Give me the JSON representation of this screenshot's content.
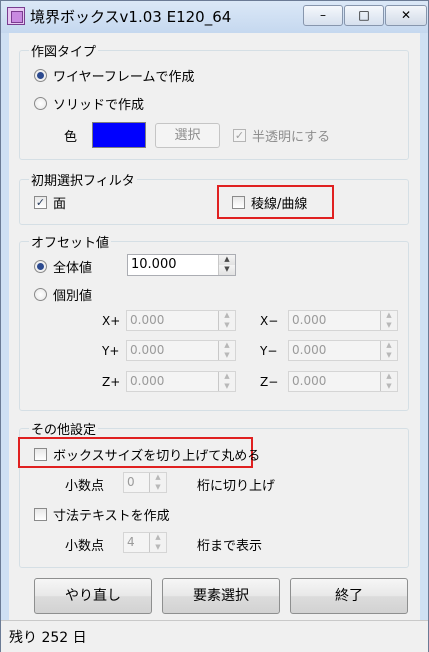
{
  "window": {
    "title": "境界ボックスv1.03 E120_64",
    "controls": {
      "minimize": "–",
      "maximize": "□",
      "close": "✕"
    }
  },
  "draw_type": {
    "legend": "作図タイプ",
    "wireframe_label": "ワイヤーフレームで作成",
    "wireframe_selected": true,
    "solid_label": "ソリッドで作成",
    "solid_selected": false,
    "color_label": "色",
    "color_value": "#0000ff",
    "select_button": "選択",
    "translucent_label": "半透明にする",
    "translucent_checked": true
  },
  "filter": {
    "legend": "初期選択フィルタ",
    "face_label": "面",
    "face_checked": true,
    "edge_label": "稜線/曲線",
    "edge_checked": false
  },
  "offset": {
    "legend": "オフセット値",
    "all_label": "全体値",
    "all_selected": true,
    "all_value": "10.000",
    "individual_label": "個別値",
    "individual_selected": false,
    "axes": {
      "xp": {
        "label": "X+",
        "value": "0.000"
      },
      "xm": {
        "label": "X−",
        "value": "0.000"
      },
      "yp": {
        "label": "Y+",
        "value": "0.000"
      },
      "ym": {
        "label": "Y−",
        "value": "0.000"
      },
      "zp": {
        "label": "Z+",
        "value": "0.000"
      },
      "zm": {
        "label": "Z−",
        "value": "0.000"
      }
    }
  },
  "other": {
    "legend": "その他設定",
    "roundup_label": "ボックスサイズを切り上げて丸める",
    "roundup_checked": false,
    "decimal_label": "小数点",
    "decimal_value_1": "0",
    "roundup_suffix": "桁に切り上げ",
    "dimtext_label": "寸法テキストを作成",
    "dimtext_checked": false,
    "decimal_value_2": "4",
    "display_suffix": "桁まで表示"
  },
  "buttons": {
    "redo": "やり直し",
    "select": "要素選択",
    "finish": "終了"
  },
  "status": {
    "remaining": "残り 252 日"
  },
  "colors": {
    "highlight": "#e02020",
    "color_swatch": "#0000ff"
  }
}
